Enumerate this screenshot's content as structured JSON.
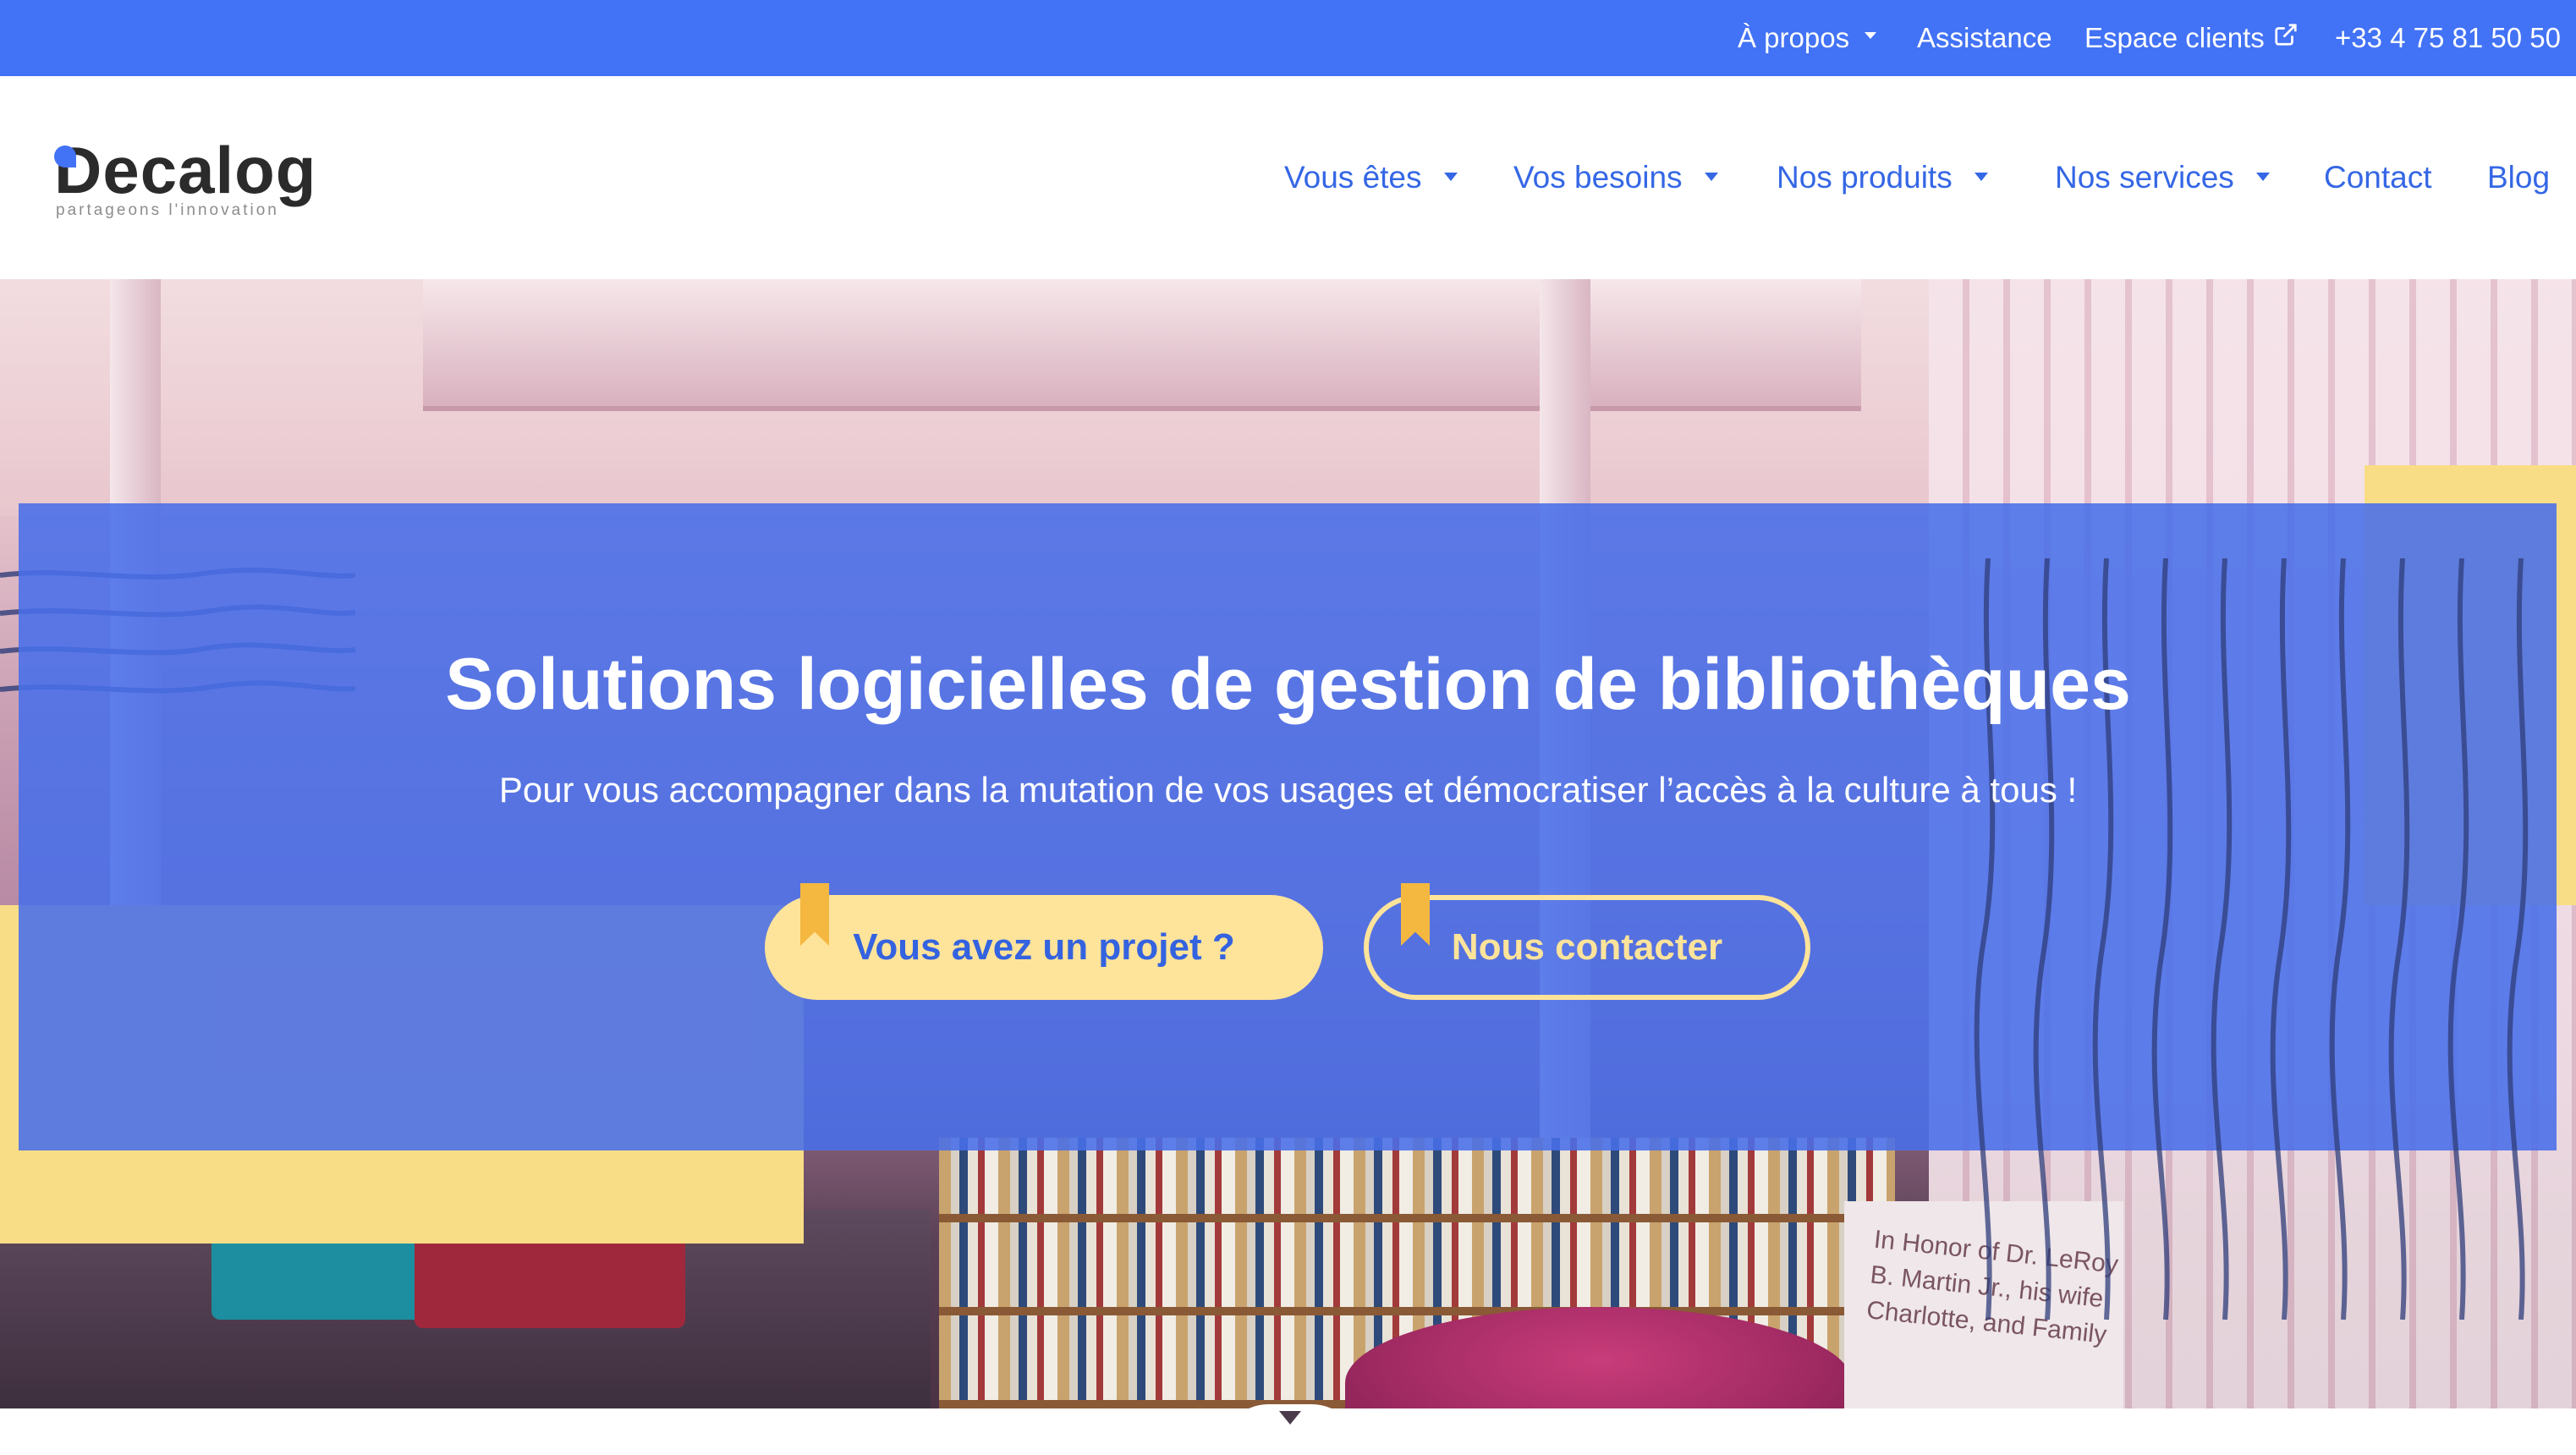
{
  "topbar": {
    "about_label": "À propos",
    "assistance_label": "Assistance",
    "client_space_label": "Espace clients",
    "phone": "+33 4 75 81 50 50"
  },
  "logo": {
    "wordmark": "Decalog",
    "tagline": "partageons l'innovation"
  },
  "nav": {
    "items": [
      {
        "label": "Vous êtes",
        "has_dropdown": true
      },
      {
        "label": "Vos besoins",
        "has_dropdown": true
      },
      {
        "label": "Nos produits",
        "has_dropdown": true
      },
      {
        "label": "Nos services",
        "has_dropdown": true
      },
      {
        "label": "Contact",
        "has_dropdown": false
      },
      {
        "label": "Blog",
        "has_dropdown": false
      }
    ]
  },
  "hero": {
    "title": "Solutions logicielles de gestion de bibliothèques",
    "subtitle": "Pour vous accompagner dans la mutation de vos usages et démocratiser l’accès à la culture à tous !",
    "primary_button": "Vous avez un projet ?",
    "secondary_button": "Nous contacter",
    "photo_plaque_text": "In Honor of Dr. LeRoy B. Martin Jr., his wife Charlotte, and Family"
  },
  "colors": {
    "brand_blue": "#4272f5",
    "nav_text_blue": "#3567e5",
    "accent_yellow": "#fee39a",
    "bookmark_gold": "#f4b740"
  },
  "icons": {
    "about_caret": "chevron-down-icon",
    "external_link": "external-link-icon"
  }
}
